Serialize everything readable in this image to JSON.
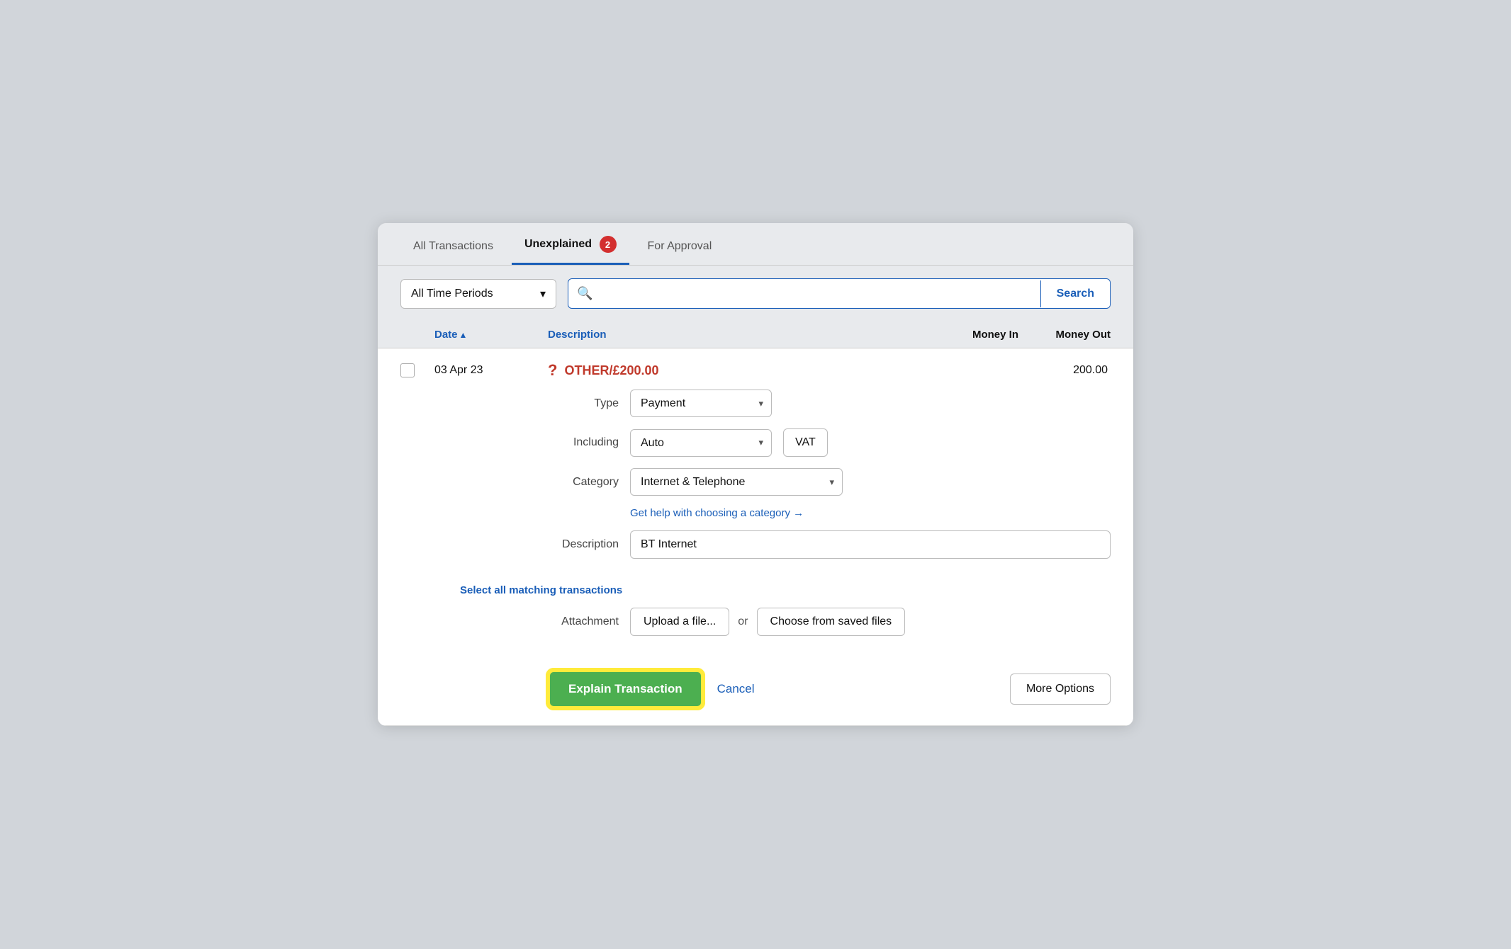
{
  "tabs": [
    {
      "id": "all",
      "label": "All Transactions",
      "active": false
    },
    {
      "id": "unexplained",
      "label": "Unexplained",
      "active": true,
      "badge": "2"
    },
    {
      "id": "approval",
      "label": "For Approval",
      "active": false
    }
  ],
  "toolbar": {
    "time_period_label": "All Time Periods",
    "search_placeholder": "",
    "search_button_label": "Search"
  },
  "table": {
    "columns": {
      "date": "Date",
      "sort_indicator": "▲",
      "description": "Description",
      "money_in": "Money In",
      "money_out": "Money Out"
    }
  },
  "transaction": {
    "date": "03 Apr 23",
    "question_mark": "?",
    "label": "OTHER/£200.00",
    "money_out": "200.00",
    "type_label": "Type",
    "type_value": "Payment",
    "including_label": "Including",
    "including_value": "Auto",
    "vat_label": "VAT",
    "category_label": "Category",
    "category_value": "Internet & Telephone",
    "help_link": "Get help with choosing a category →",
    "description_label": "Description",
    "description_value": "BT Internet",
    "matching_link": "Select all matching transactions",
    "attachment_label": "Attachment",
    "upload_button": "Upload a file...",
    "or_text": "or",
    "saved_files_button": "Choose from saved files"
  },
  "actions": {
    "explain_button": "Explain Transaction",
    "cancel_link": "Cancel",
    "more_options_button": "More Options"
  },
  "icons": {
    "search": "🔍",
    "chevron_down": "▾"
  }
}
